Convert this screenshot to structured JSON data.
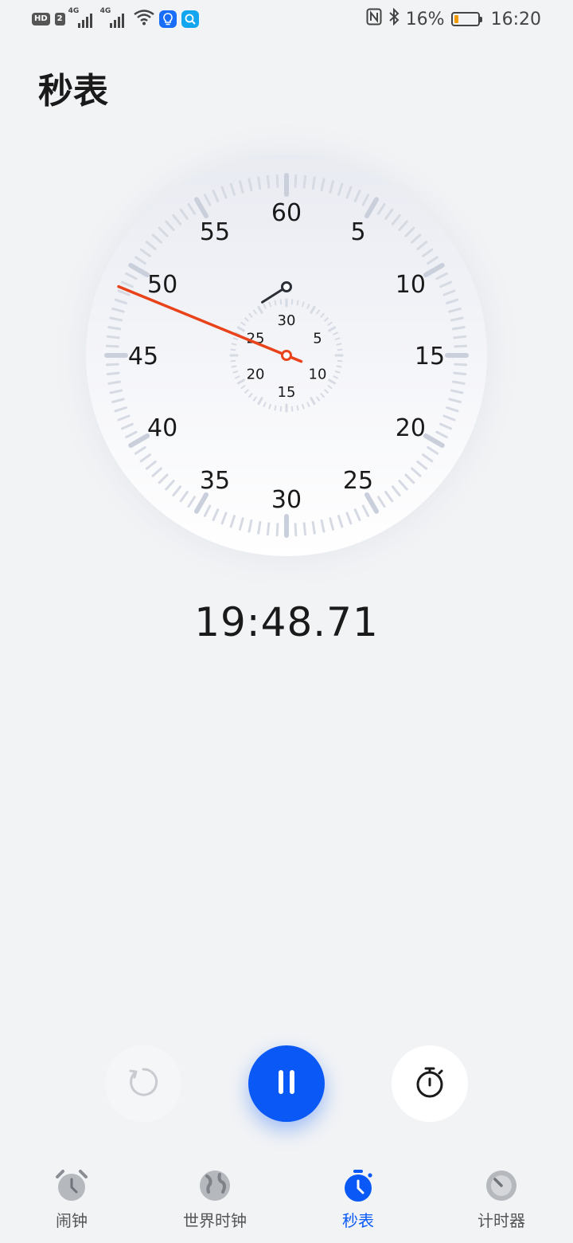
{
  "status_bar": {
    "hd": "HD",
    "sim": "2",
    "net1": "4G",
    "net2": "4G",
    "battery_percent": "16%",
    "battery_level": 0.16,
    "time": "16:20"
  },
  "page": {
    "title": "秒表"
  },
  "dial": {
    "outer_labels": [
      "60",
      "5",
      "10",
      "15",
      "20",
      "25",
      "30",
      "35",
      "40",
      "45",
      "50",
      "55"
    ],
    "inner_labels": [
      "30",
      "5",
      "10",
      "15",
      "20",
      "25"
    ],
    "main_hand_seconds": 48.71,
    "sub_hand_minutes": 19.8,
    "main_hand_color": "#e8431a",
    "sub_hand_color": "#2b2f36"
  },
  "stopwatch": {
    "time": "19:48.71"
  },
  "controls": {
    "reset_icon": "reset-icon",
    "pause_icon": "pause-icon",
    "lap_icon": "lap-stopwatch-icon",
    "accent": "#0a59f7"
  },
  "tabs": [
    {
      "label": "闹钟",
      "icon": "alarm-clock-icon",
      "active": false
    },
    {
      "label": "世界时钟",
      "icon": "globe-icon",
      "active": false
    },
    {
      "label": "秒表",
      "icon": "stopwatch-icon",
      "active": true
    },
    {
      "label": "计时器",
      "icon": "timer-icon",
      "active": false
    }
  ]
}
